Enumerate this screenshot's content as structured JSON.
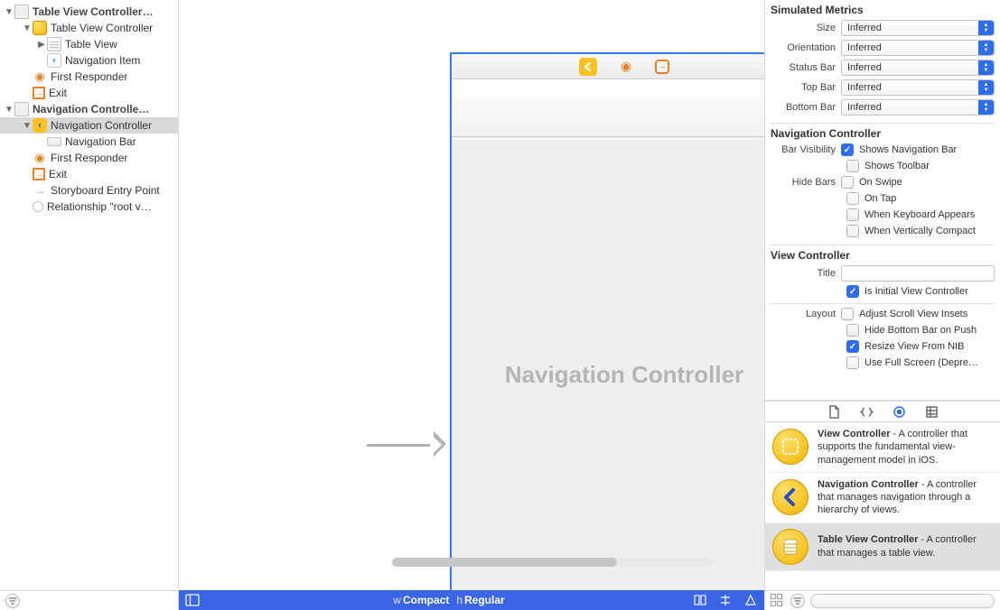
{
  "outline": {
    "scenes": [
      {
        "title": "Table View Controller…",
        "expanded": true,
        "children": [
          {
            "label": "Table View Controller",
            "icon": "yellow-square",
            "expanded": true,
            "depth": 1,
            "children": [
              {
                "label": "Table View",
                "icon": "table-view",
                "expanded": false,
                "collapsed": true,
                "depth": 2
              },
              {
                "label": "Navigation Item",
                "icon": "back",
                "depth": 2
              }
            ]
          },
          {
            "label": "First Responder",
            "icon": "cube",
            "depth": 1
          },
          {
            "label": "Exit",
            "icon": "exit",
            "depth": 1
          }
        ]
      },
      {
        "title": "Navigation Controlle…",
        "expanded": true,
        "children": [
          {
            "label": "Navigation Controller",
            "icon": "yellow-back",
            "expanded": true,
            "depth": 1,
            "selected": true,
            "children": [
              {
                "label": "Navigation Bar",
                "icon": "navbar",
                "depth": 2
              }
            ]
          },
          {
            "label": "First Responder",
            "icon": "cube",
            "depth": 1
          },
          {
            "label": "Exit",
            "icon": "exit",
            "depth": 1
          },
          {
            "label": "Storyboard Entry Point",
            "icon": "arrow",
            "depth": 1
          },
          {
            "label": "Relationship \"root v…",
            "icon": "circle",
            "depth": 1
          }
        ]
      }
    ]
  },
  "canvas": {
    "scene_title": "Navigation Controller",
    "size_label_w": "w",
    "size_label_compact": "Compact",
    "size_label_h": "h",
    "size_label_regular": "Regular"
  },
  "inspector": {
    "sim_metrics": {
      "header": "Simulated Metrics",
      "rows": [
        {
          "label": "Size",
          "value": "Inferred"
        },
        {
          "label": "Orientation",
          "value": "Inferred"
        },
        {
          "label": "Status Bar",
          "value": "Inferred"
        },
        {
          "label": "Top Bar",
          "value": "Inferred"
        },
        {
          "label": "Bottom Bar",
          "value": "Inferred"
        }
      ]
    },
    "nav_controller": {
      "header": "Navigation Controller",
      "bar_visibility_label": "Bar Visibility",
      "hide_bars_label": "Hide Bars",
      "checks": {
        "shows_nav": {
          "label": "Shows Navigation Bar",
          "checked": true
        },
        "shows_toolbar": {
          "label": "Shows Toolbar",
          "checked": false
        },
        "on_swipe": {
          "label": "On Swipe",
          "checked": false
        },
        "on_tap": {
          "label": "On Tap",
          "checked": false
        },
        "keyboard": {
          "label": "When Keyboard Appears",
          "checked": false
        },
        "vertical": {
          "label": "When Vertically Compact",
          "checked": false
        }
      }
    },
    "view_controller": {
      "header": "View Controller",
      "title_label": "Title",
      "title_value": "",
      "initial": {
        "label": "Is Initial View Controller",
        "checked": true
      },
      "layout_label": "Layout",
      "layout": {
        "adjust": {
          "label": "Adjust Scroll View Insets",
          "checked": false
        },
        "hide_bottom": {
          "label": "Hide Bottom Bar on Push",
          "checked": false
        },
        "resize": {
          "label": "Resize View From NIB",
          "checked": true
        },
        "fullscreen": {
          "label": "Use Full Screen (Depre…",
          "checked": false
        }
      }
    }
  },
  "library": {
    "items": [
      {
        "title": "View Controller",
        "desc": " - A controller that supports the fundamental view-management model in iOS.",
        "icon": "vc"
      },
      {
        "title": "Navigation Controller",
        "desc": " - A controller that manages navigation through a hierarchy of views.",
        "icon": "nav"
      },
      {
        "title": "Table View Controller",
        "desc": " - A controller that manages a table view.",
        "icon": "tvc",
        "selected": true
      }
    ],
    "filter_placeholder": ""
  }
}
